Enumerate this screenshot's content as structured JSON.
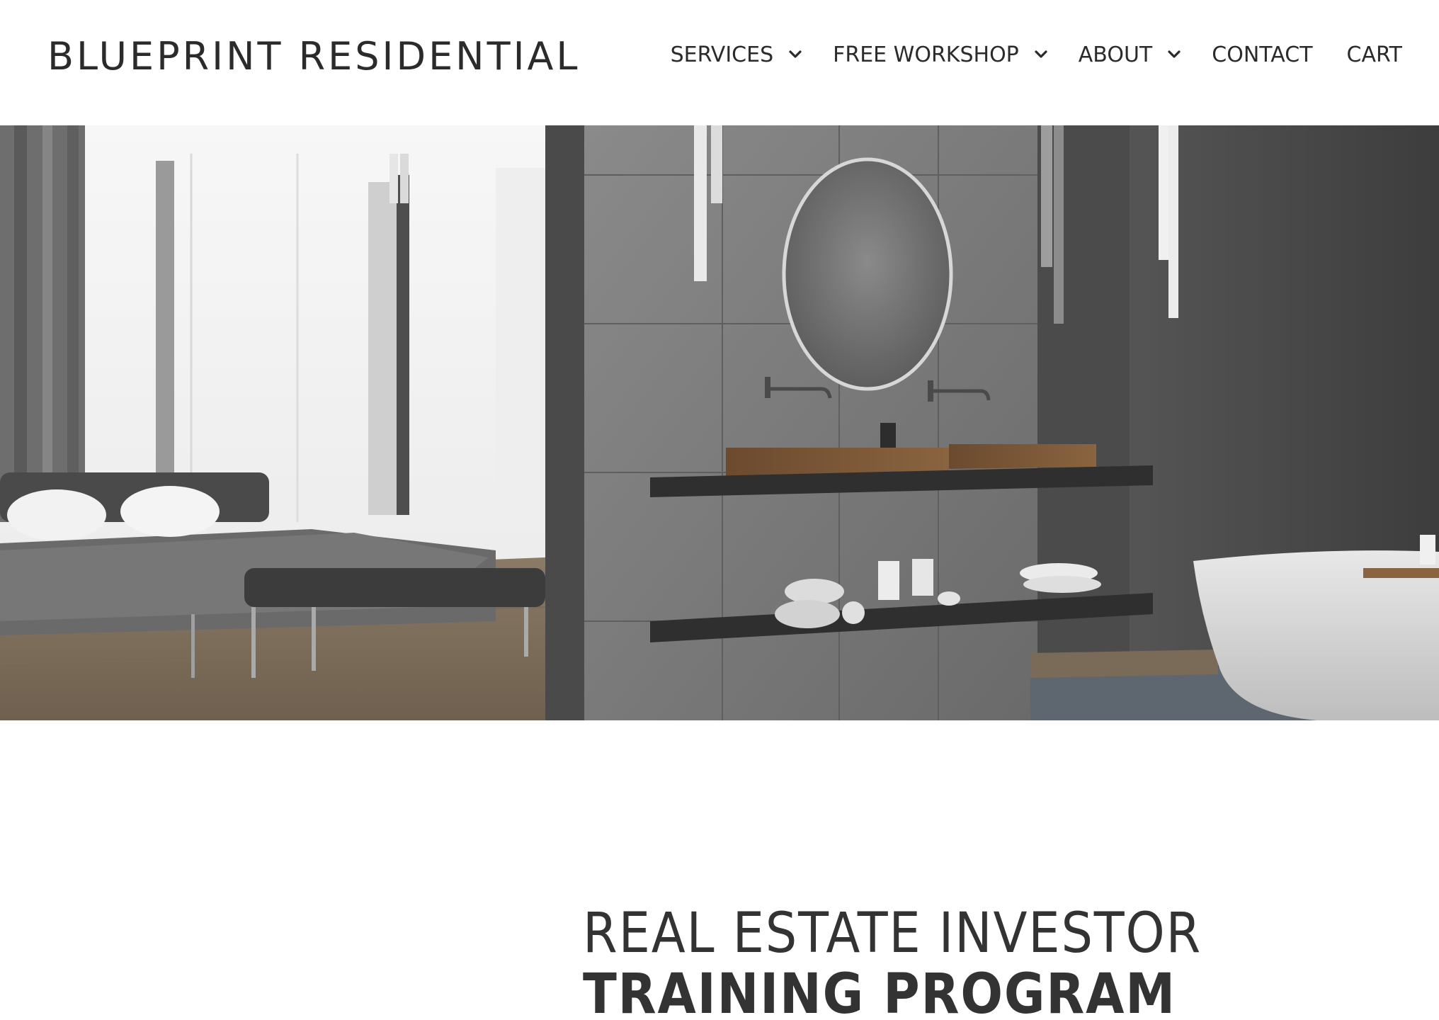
{
  "brand": {
    "name": "BLUEPRINT RESIDENTIAL"
  },
  "nav": {
    "items": [
      {
        "label": "SERVICES",
        "has_dropdown": true,
        "icon": "chevron-down-icon"
      },
      {
        "label": "FREE WORKSHOP",
        "has_dropdown": true,
        "icon": "chevron-down-icon"
      },
      {
        "label": "ABOUT",
        "has_dropdown": true,
        "icon": "chevron-down-icon"
      },
      {
        "label": "CONTACT",
        "has_dropdown": false
      },
      {
        "label": "CART",
        "has_dropdown": false
      }
    ]
  },
  "hero": {
    "image": "bedroom-and-bathroom-interior-photo"
  },
  "headline": {
    "line1": "REAL ESTATE INVESTOR",
    "line2": "TRAINING PROGRAM"
  },
  "colors": {
    "text": "#333333",
    "background": "#ffffff"
  }
}
